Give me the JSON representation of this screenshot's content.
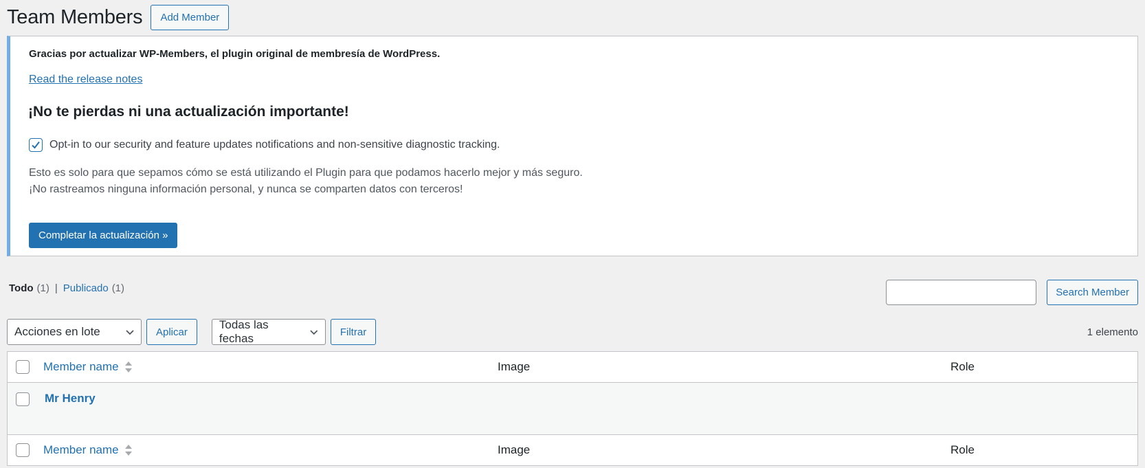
{
  "header": {
    "title": "Team Members",
    "add_button": "Add Member"
  },
  "notice": {
    "lead": "Gracias por actualizar WP-Members, el plugin original de membresía de WordPress.",
    "release_link": "Read the release notes",
    "heading": "¡No te pierdas ni una actualización importante!",
    "optin_label": "Opt-in to our security and feature updates notifications and non-sensitive diagnostic tracking.",
    "optin_checked": true,
    "desc_line1": "Esto es solo para que sepamos cómo se está utilizando el Plugin para que podamos hacerlo mejor y más seguro.",
    "desc_line2": "¡No rastreamos ninguna información personal, y nunca se comparten datos con terceros!",
    "complete_button": "Completar la actualización »"
  },
  "views": {
    "all_label": "Todo",
    "all_count": "(1)",
    "separator": "|",
    "published_label": "Publicado",
    "published_count": "(1)"
  },
  "search": {
    "value": "",
    "button": "Search Member"
  },
  "tablenav": {
    "bulk_actions": "Acciones en lote",
    "apply_button": "Aplicar",
    "date_filter": "Todas las fechas",
    "filter_button": "Filtrar",
    "items_count": "1 elemento"
  },
  "table": {
    "columns": {
      "name": "Member name",
      "image": "Image",
      "role": "Role"
    },
    "rows": [
      {
        "name": "Mr Henry",
        "image": "",
        "role": ""
      }
    ]
  },
  "colors": {
    "accent": "#2271b1",
    "notice_border": "#72aee6",
    "background": "#f0f0f1"
  }
}
